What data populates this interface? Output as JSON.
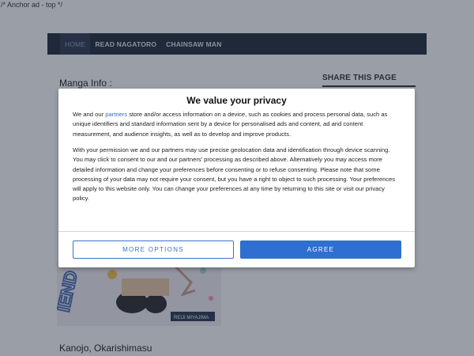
{
  "top_comment": "/* Anchor ad - top */",
  "nav": {
    "items": [
      {
        "label": "HOME"
      },
      {
        "label": "READ NAGATORO"
      },
      {
        "label": "CHAINSAW MAN"
      }
    ]
  },
  "main": {
    "manga_info_label": "Manga Info :",
    "cover_title": "Kanojo, Okarishimasu",
    "cover_artist_text": "REIJI MIYAJIMA",
    "cover_partial_word": "IEND"
  },
  "sidebar": {
    "share_title": "SHARE THIS PAGE"
  },
  "consent": {
    "title": "We value your privacy",
    "p1_before": "We and our ",
    "p1_link": "partners",
    "p1_after": " store and/or access information on a device, such as cookies and process personal data, such as unique identifiers and standard information sent by a device for personalised ads and content, ad and content measurement, and audience insights, as well as to develop and improve products.",
    "p2": "With your permission we and our partners may use precise geolocation data and identification through device scanning. You may click to consent to our and our partners’ processing as described above. Alternatively you may access more detailed information and change your preferences before consenting or to refuse consenting. Please note that some processing of your data may not require your consent, but you have a right to object to such processing. Your preferences will apply to this website only. You can change your preferences at any time by returning to this site or visit our privacy policy.",
    "more_options_label": "MORE OPTIONS",
    "agree_label": "AGREE"
  },
  "colors": {
    "nav_bg": "#1f2a3a",
    "accent_blue": "#2f6fd0",
    "overlay": "rgba(30,40,60,0.45)"
  }
}
